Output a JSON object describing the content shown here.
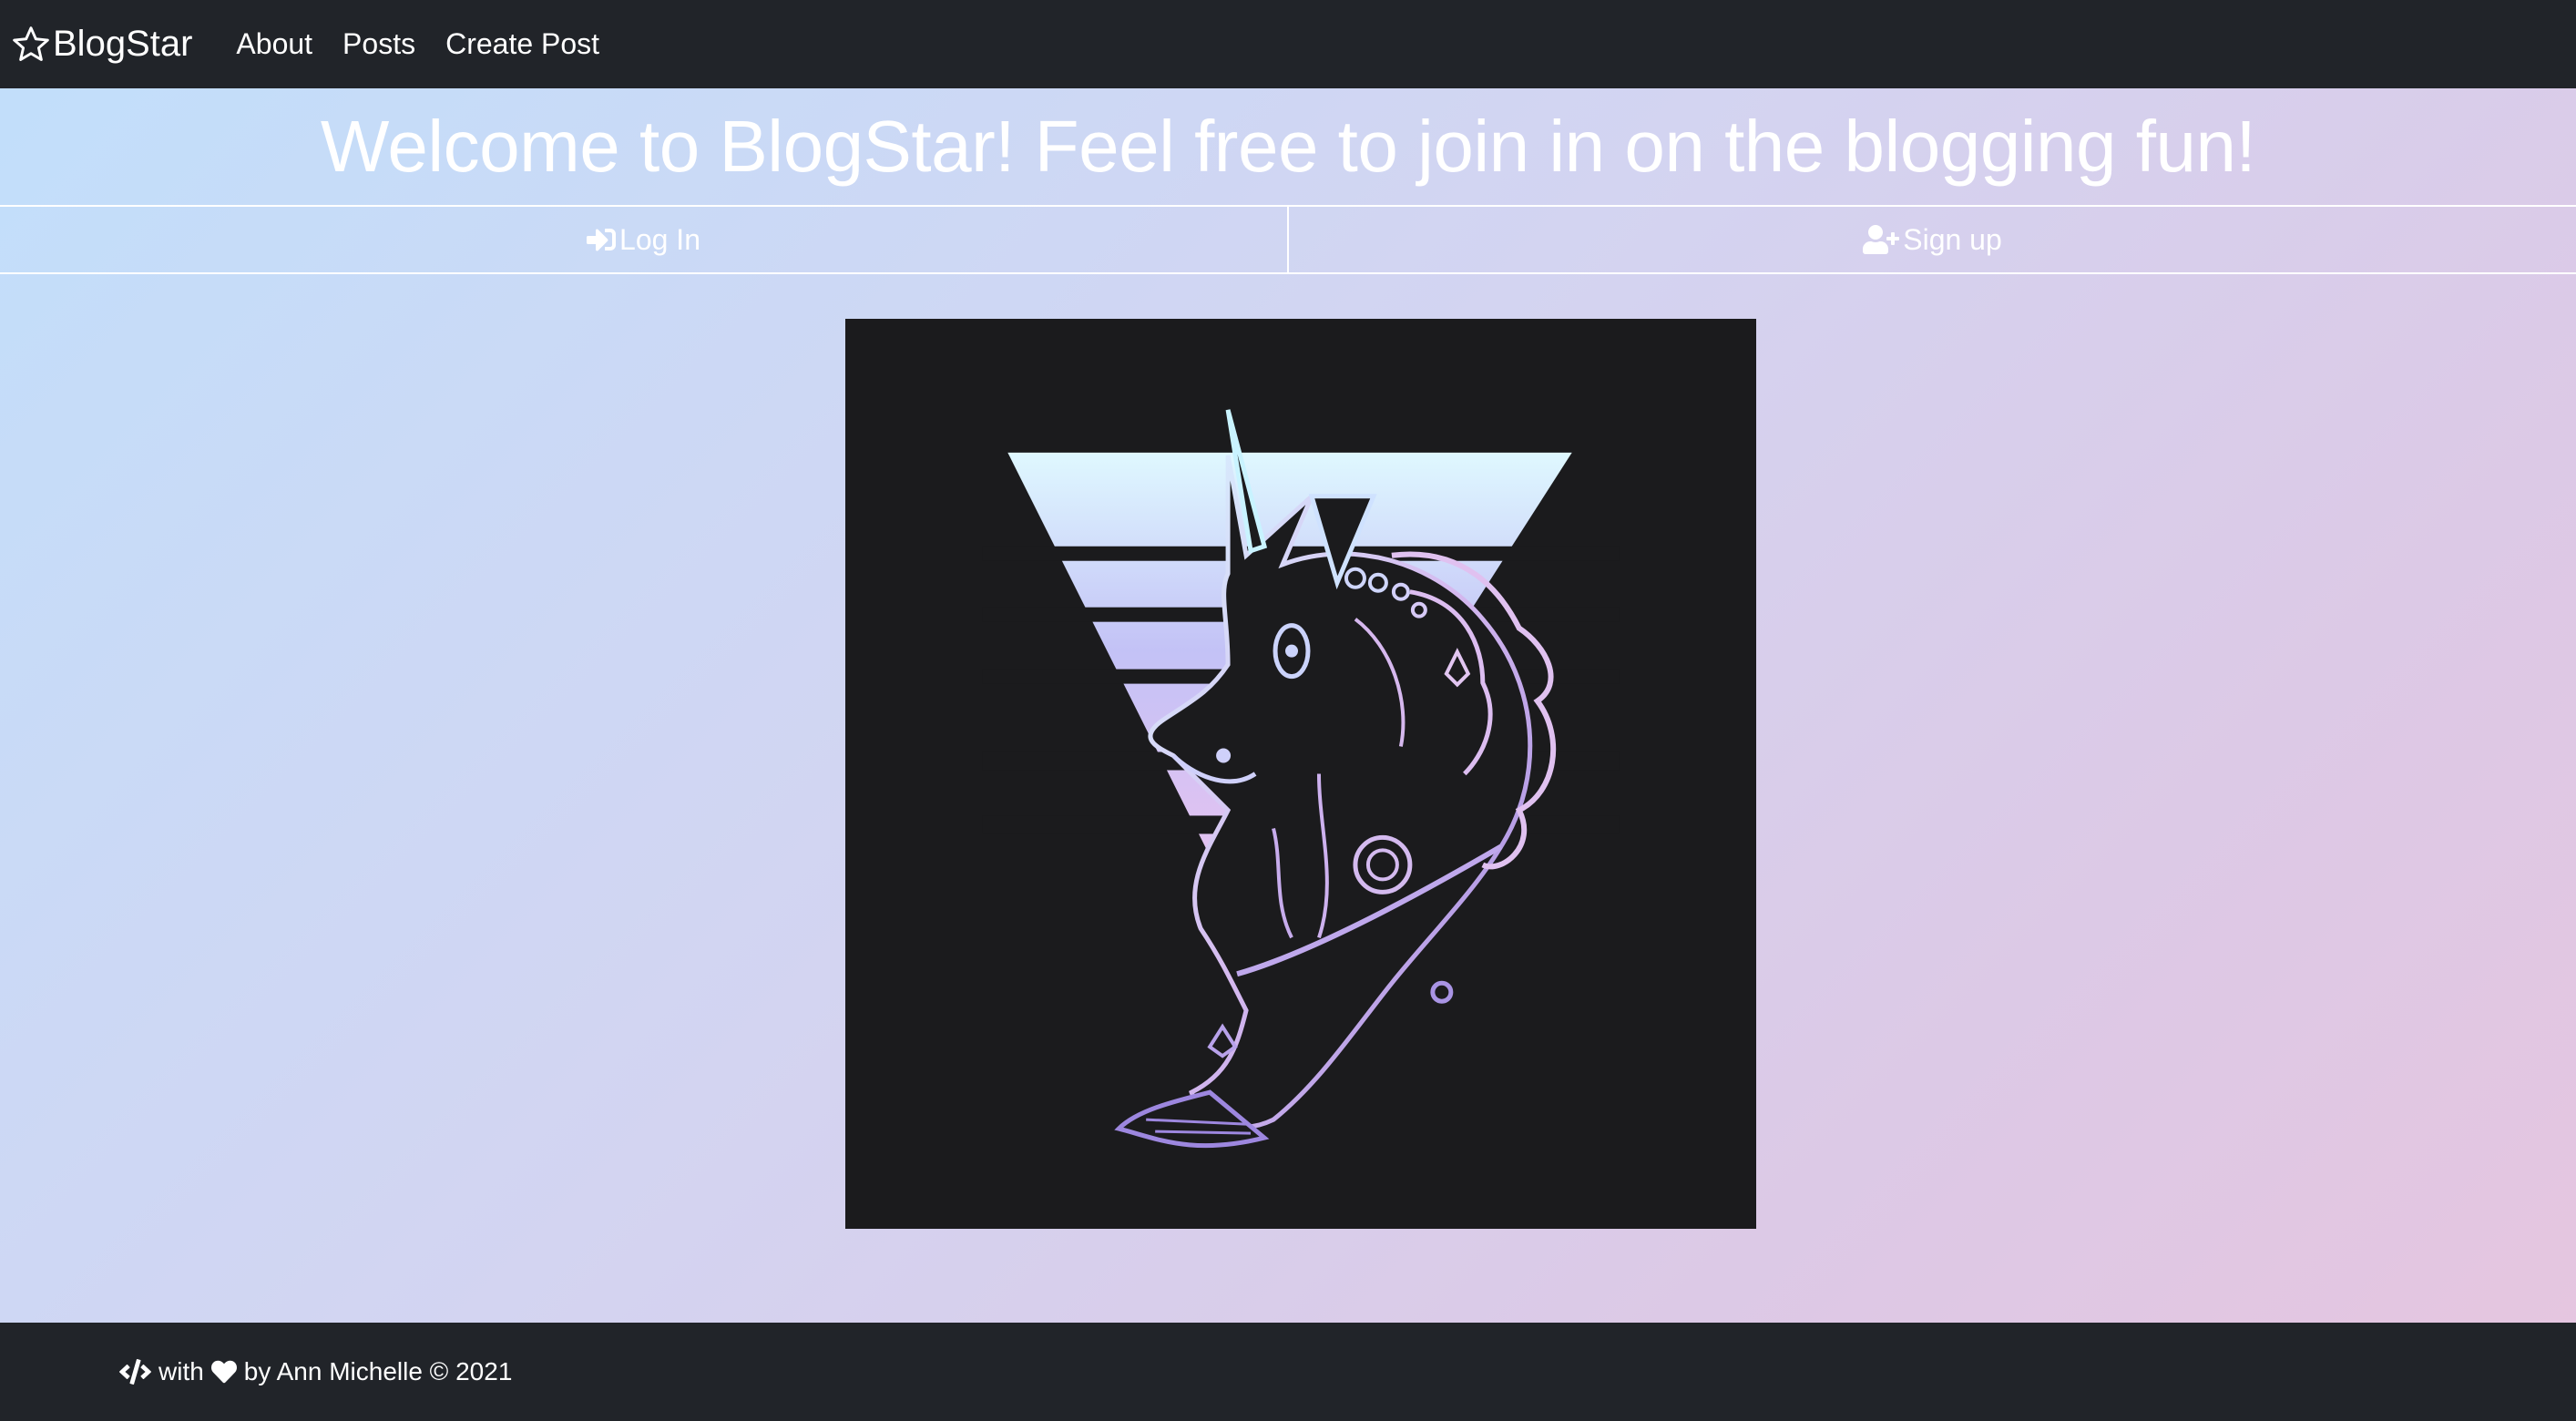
{
  "nav": {
    "brand": "BlogStar",
    "links": [
      "About",
      "Posts",
      "Create Post"
    ]
  },
  "hero": {
    "heading": "Welcome to BlogStar! Feel free to join in on the blogging fun!"
  },
  "auth": {
    "login_label": "Log In",
    "signup_label": "Sign up"
  },
  "footer": {
    "with_text": "with",
    "credit_text": "by Ann Michelle © 2021"
  },
  "icons": {
    "brand": "star-outline-icon",
    "login": "sign-in-icon",
    "signup": "user-plus-icon",
    "footer_code": "code-icon",
    "footer_heart": "heart-icon"
  },
  "colors": {
    "navbar_bg": "#212429",
    "gradient_start": "#c1dffb",
    "gradient_end": "#e6c5df",
    "image_bg": "#1b1b1d",
    "text": "#ffffff"
  }
}
